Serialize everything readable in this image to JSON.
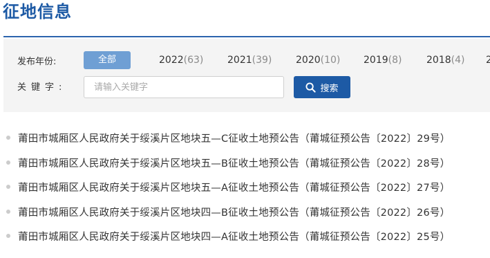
{
  "page": {
    "title": "征地信息"
  },
  "filter": {
    "year_label": "发布年份:",
    "keyword_label": "关键字:",
    "all_label": "全部",
    "years": [
      {
        "year": "2022",
        "count": "(63)"
      },
      {
        "year": "2021",
        "count": "(39)"
      },
      {
        "year": "2020",
        "count": "(10)"
      },
      {
        "year": "2019",
        "count": "(8)"
      },
      {
        "year": "2018",
        "count": "(4)"
      },
      {
        "year": "2",
        "count": ""
      }
    ],
    "search_placeholder": "请输入关键字",
    "search_button_label": "搜索"
  },
  "notices": [
    {
      "title": "莆田市城厢区人民政府关于绥溪片区地块五—C征收土地预公告（莆城征预公告〔2022〕29号）"
    },
    {
      "title": "莆田市城厢区人民政府关于绥溪片区地块五—B征收土地预公告（莆城征预公告〔2022〕28号）"
    },
    {
      "title": "莆田市城厢区人民政府关于绥溪片区地块五—A征收土地预公告（莆城征预公告〔2022〕27号）"
    },
    {
      "title": "莆田市城厢区人民政府关于绥溪片区地块四—B征收土地预公告（莆城征预公告〔2022〕26号）"
    },
    {
      "title": "莆田市城厢区人民政府关于绥溪片区地块四—A征收土地预公告（莆城征预公告〔2022〕25号）"
    }
  ],
  "colors": {
    "accent": "#1d5aa5",
    "active_tab": "#6f9fd4",
    "panel_bg": "#f4f4f4"
  }
}
